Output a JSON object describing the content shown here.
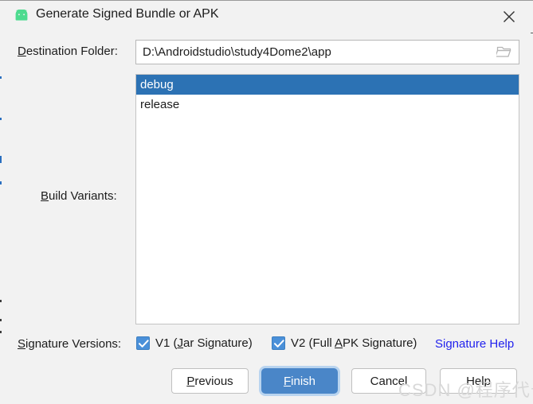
{
  "window": {
    "title": "Generate Signed Bundle or APK",
    "app_icon": "android-robot-icon",
    "close_icon": "close-icon"
  },
  "destination": {
    "label_pre": "D",
    "label_post": "estination Folder:",
    "value": "D:\\Androidstudio\\study4Dome2\\app",
    "placeholder": "Destination Folder",
    "browse_icon": "folder-open-icon"
  },
  "build_variants": {
    "label_pre": "B",
    "label_post": "uild Variants:",
    "items": [
      {
        "label": "debug",
        "selected": true
      },
      {
        "label": "release",
        "selected": false
      }
    ],
    "selected_value": "debug"
  },
  "signature": {
    "label_pre": "S",
    "label_post": "ignature Versions:",
    "v1": {
      "pre": "V1 (",
      "mnemonic": "J",
      "post": "ar Signature)",
      "checked": true
    },
    "v2": {
      "pre": "V2 (Full ",
      "mnemonic": "A",
      "post": "PK Signature)",
      "checked": true
    },
    "help_link": "Signature Help"
  },
  "buttons": {
    "previous": {
      "pre": "P",
      "mnemonic": "",
      "label_pre": "",
      "mn": "P",
      "rest": "revious"
    },
    "finish": {
      "mn": "F",
      "rest": "inish"
    },
    "cancel": {
      "mn": "",
      "rest": "Cancel"
    },
    "help": {
      "mn": "",
      "rest": "Help"
    }
  },
  "watermark": {
    "text": "CSDN @程序代号"
  },
  "colors": {
    "dialog_bg": "#f2f2f2",
    "selection_blue": "#2c72b4",
    "checkbox_blue": "#4a90d9",
    "link_blue": "#2222ee",
    "default_button_blue": "#4a86c8",
    "focus_ring": "#b9d4ef",
    "android_green": "#4ddb8f"
  }
}
